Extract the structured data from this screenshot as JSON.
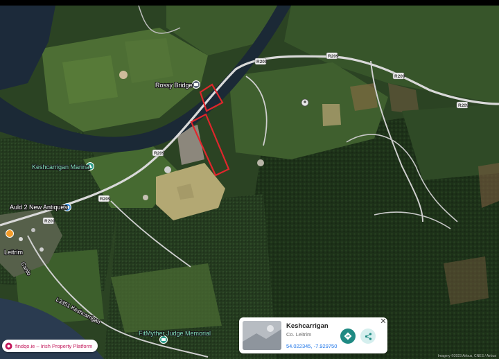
{
  "map": {
    "type": "satellite",
    "road_labels": [
      "R209",
      "R209",
      "R209",
      "R209",
      "R209",
      "R209",
      "R209"
    ],
    "place_labels": [
      {
        "name": "Rossy Bridge",
        "kind": "place"
      },
      {
        "name": "Keshcarrigan Marina",
        "kind": "poi"
      },
      {
        "name": "Auld 2 New Antiques",
        "kind": "poi"
      },
      {
        "name": "Leitrim",
        "kind": "place"
      },
      {
        "name": "FitMyther Judge Memorial",
        "kind": "poi"
      }
    ],
    "street_labels": [
      "Canlo",
      "L3351 Keshcarrigan"
    ],
    "colors": {
      "boundary": "#e0262c",
      "water": "#1c2a3a",
      "road": "#d9d9d9"
    }
  },
  "info_card": {
    "title": "Keshcarrigan",
    "subtitle": "Co. Leitrim",
    "coordinates": "54.022345, -7.929750",
    "directions_icon": "directions-icon",
    "share_icon": "share-icon",
    "close_label": "✕"
  },
  "brand": {
    "text": "findqo.ie – Irish Property Platform",
    "color": "#c2185b"
  },
  "attribution": "Imagery ©2023 Airbus, CNES / Airbus"
}
